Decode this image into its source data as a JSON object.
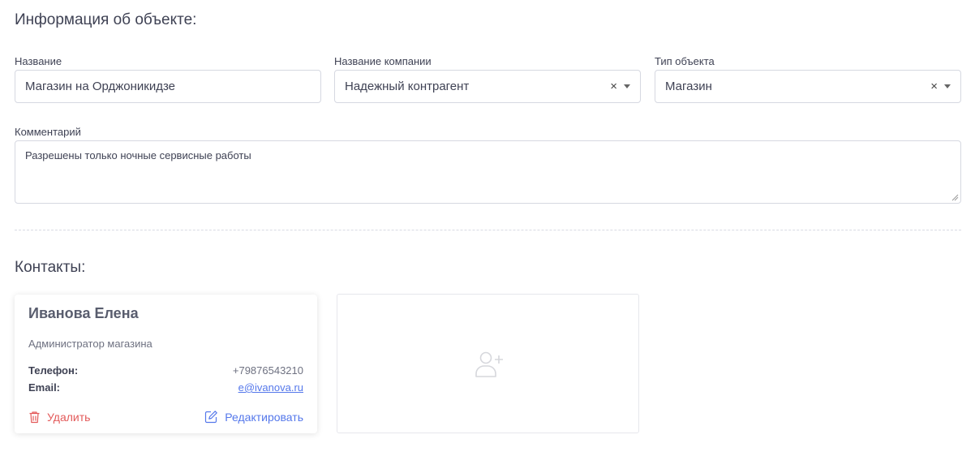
{
  "section_info": {
    "title": "Информация об объекте:"
  },
  "fields": {
    "name": {
      "label": "Название",
      "value": "Магазин на Орджоникидзе"
    },
    "company": {
      "label": "Название компании",
      "value": "Надежный контрагент",
      "clear": "×"
    },
    "object_type": {
      "label": "Тип объекта",
      "value": "Магазин",
      "clear": "×"
    },
    "comment": {
      "label": "Комментарий",
      "value": "Разрешены только ночные сервисные работы"
    }
  },
  "section_contacts": {
    "title": "Контакты:"
  },
  "contacts": [
    {
      "name": "Иванова Елена",
      "role": "Администратор магазина",
      "phone_label": "Телефон:",
      "phone": "+79876543210",
      "email_label": "Email:",
      "email": "e@ivanova.ru",
      "delete_label": "Удалить",
      "edit_label": "Редактировать"
    }
  ],
  "add_contact": {
    "icon": "user-plus-icon"
  },
  "colors": {
    "danger": "#e35a5a",
    "primary": "#5578eb",
    "text": "#3f4254"
  }
}
